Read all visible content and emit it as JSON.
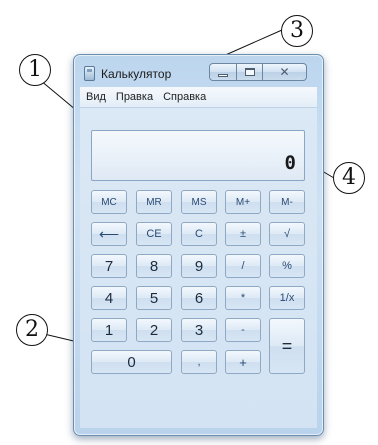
{
  "window": {
    "title": "Калькулятор",
    "buttons": {
      "close_glyph": "✕",
      "minimize": "minimize-icon",
      "maximize": "maximize-icon"
    }
  },
  "menu": [
    "Вид",
    "Правка",
    "Справка"
  ],
  "display": {
    "value": "0"
  },
  "keys": {
    "mc": "MC",
    "mr": "MR",
    "ms": "MS",
    "mplus": "M+",
    "mminus": "M-",
    "backspace": "⟵",
    "ce": "CE",
    "c": "C",
    "plusminus": "±",
    "sqrt": "√",
    "n7": "7",
    "n8": "8",
    "n9": "9",
    "div": "/",
    "pct": "%",
    "n4": "4",
    "n5": "5",
    "n6": "6",
    "mul": "*",
    "inv": "1/x",
    "n1": "1",
    "n2": "2",
    "n3": "3",
    "sub": "-",
    "eq": "=",
    "n0": "0",
    "dot": ",",
    "add": "+"
  },
  "callouts": {
    "c1": "1",
    "c2": "2",
    "c3": "3",
    "c4": "4"
  },
  "colors": {
    "window_frame": "#bcd6ee",
    "key_text": "#2a4a73"
  }
}
